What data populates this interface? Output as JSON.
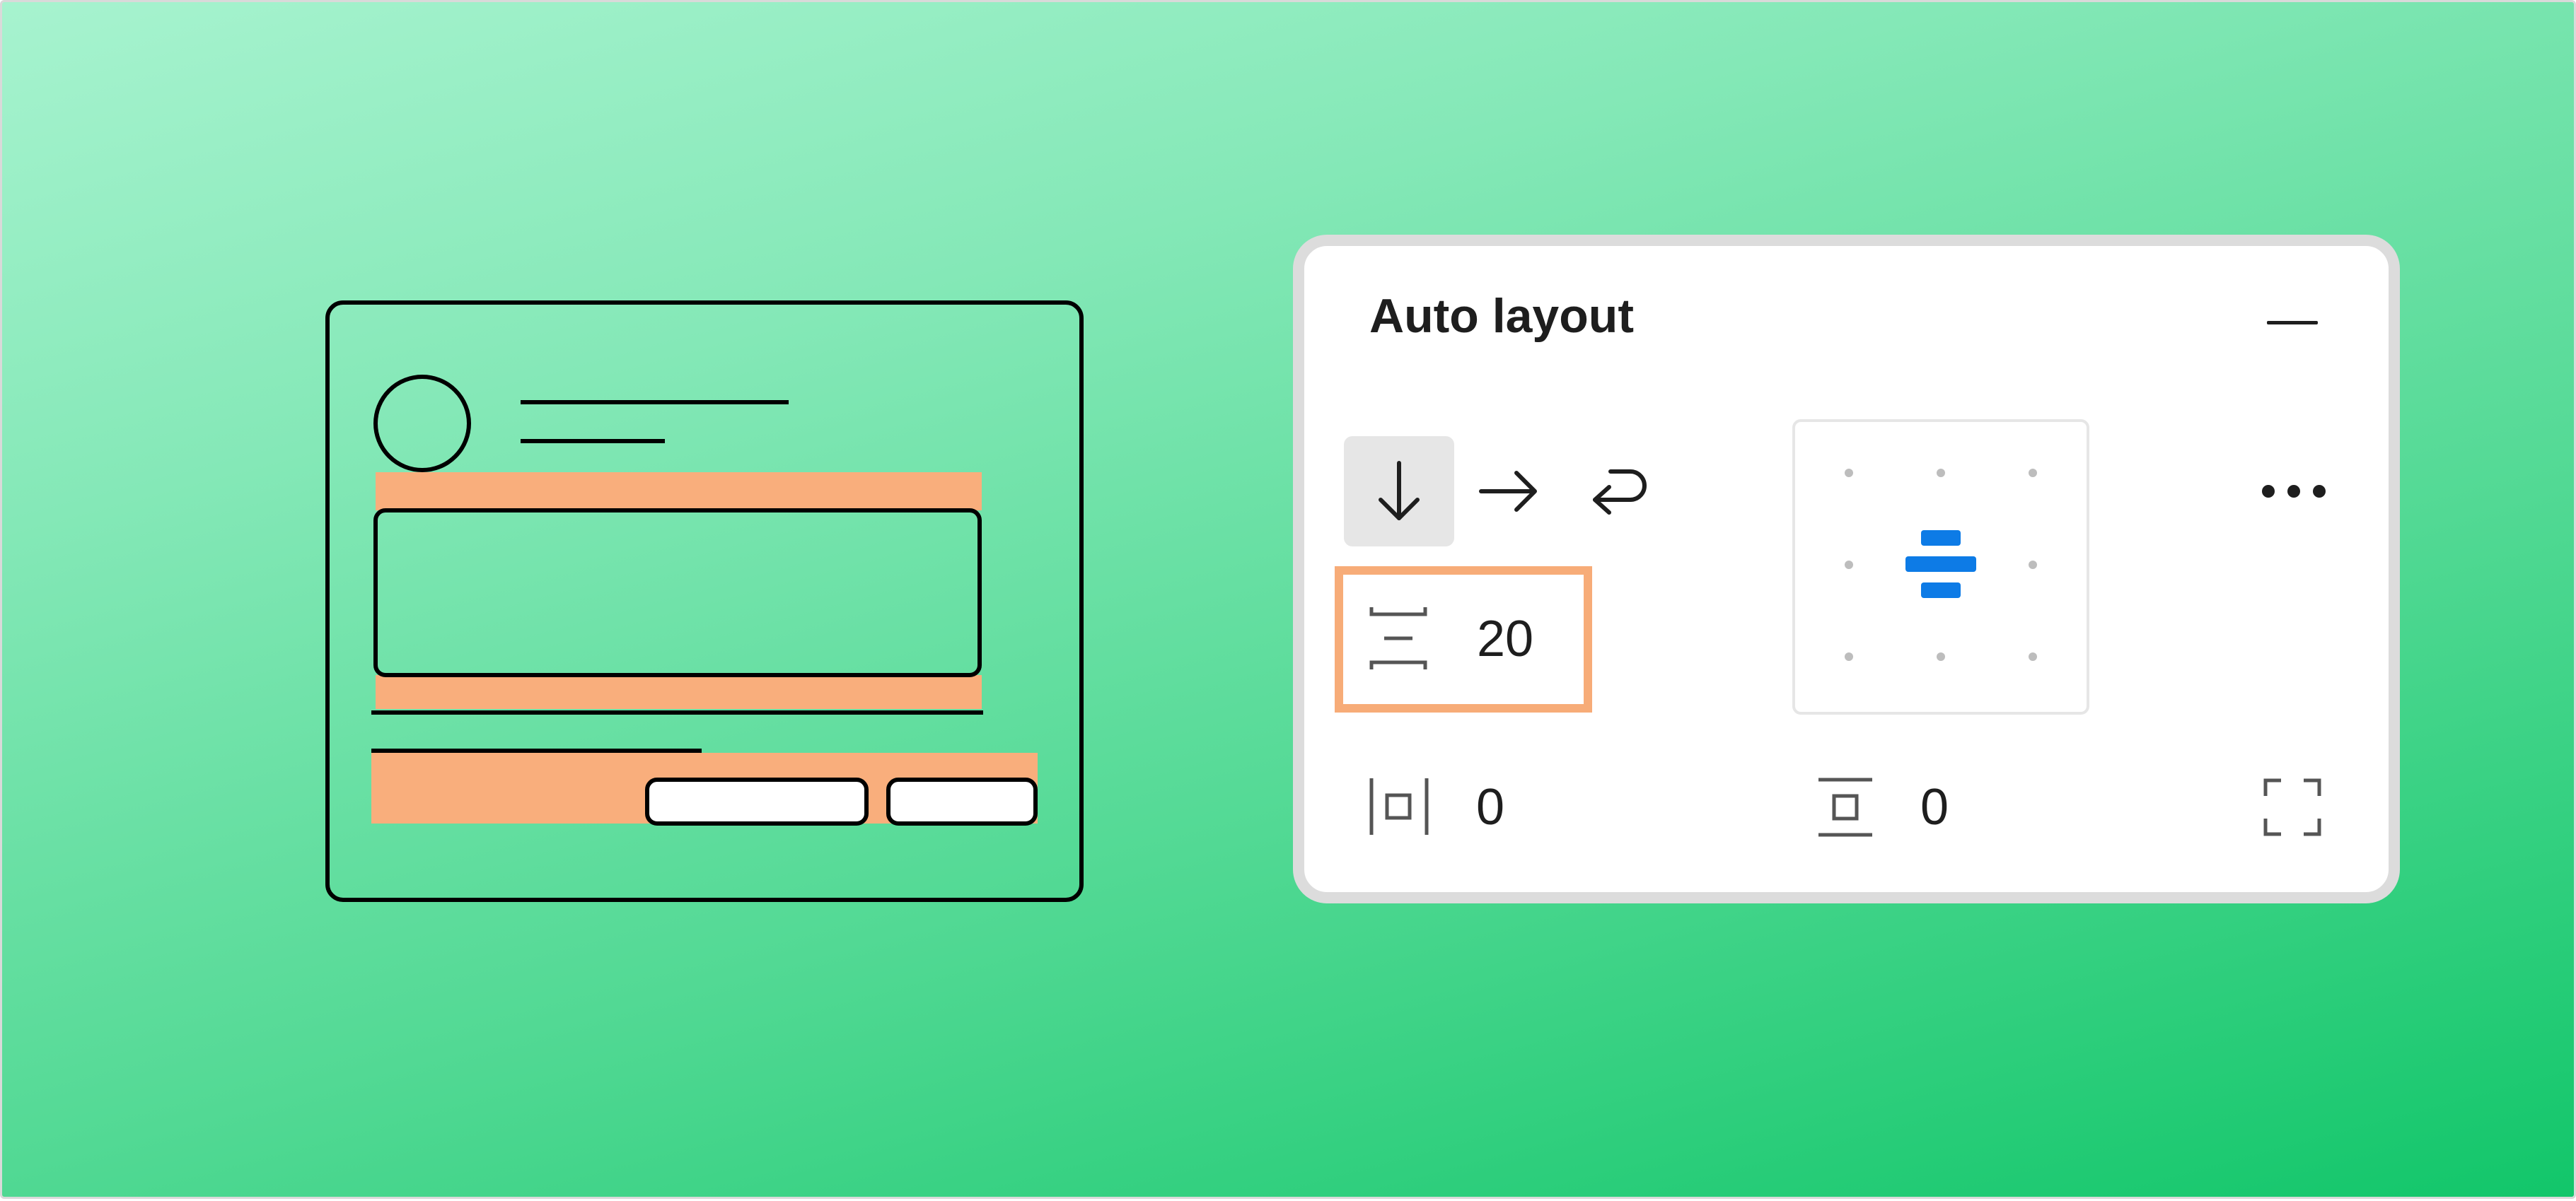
{
  "panel": {
    "title": "Auto layout"
  },
  "direction": {
    "options": [
      {
        "name": "vertical",
        "icon": "arrow-down-icon",
        "active": true
      },
      {
        "name": "horizontal",
        "icon": "arrow-right-icon",
        "active": false
      },
      {
        "name": "wrap",
        "icon": "wrap-icon",
        "active": false
      }
    ]
  },
  "spacing": {
    "gap_between": "20",
    "horizontal_padding": "0",
    "vertical_padding": "0"
  },
  "alignment": {
    "selected": "center"
  },
  "colors": {
    "accent_blue": "#0d7be6",
    "highlight_orange": "#f7ac78",
    "text_dark": "#1e1e1e"
  }
}
